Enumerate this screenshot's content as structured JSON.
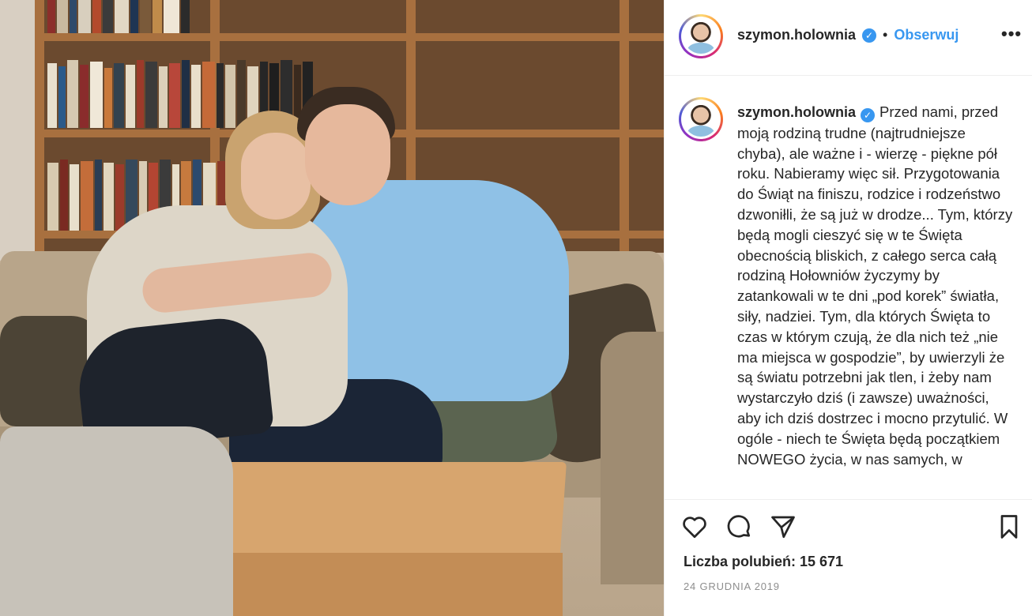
{
  "post": {
    "username": "szymon.holownia",
    "follow_label": "Obserwuj",
    "separator": "•",
    "more_label": "•••",
    "caption": "Przed nami, przed moją rodziną trudne (najtrudniejsze chyba), ale ważne i - wierzę - piękne pół roku. Nabieramy więc sił. Przygotowania do Świąt na finiszu, rodzice i rodzeństwo dzwoniłli, że są już w drodze... Tym, którzy będą mogli cieszyć się w te Święta obecnością bliskich, z całego serca całą rodziną Hołowniów życzymy by zatankowali w te dni „pod korek” światła, siły, nadziei. Tym, dla których Święta to czas w którym czują, że dla nich też „nie ma miejsca w gospodzie”, by uwierzyli że są światu potrzebni jak tlen, i żeby nam wystarczyło dziś (i zawsze) uważności, aby ich dziś dostrzec i mocno przytulić. W ogóle - niech te Święta będą początkiem NOWEGO życia, w nas samych, w",
    "likes_text": "Liczba polubień: 15 671",
    "date": "24 GRUDNIA 2019"
  },
  "icons": {
    "verified": "verified-badge-icon",
    "like": "heart-icon",
    "comment": "comment-icon",
    "share": "paper-plane-icon",
    "save": "bookmark-icon",
    "more": "more-options-icon"
  },
  "colors": {
    "accent_blue": "#3897f0",
    "text": "#262626",
    "muted": "#8e8e8e",
    "border": "#efefef"
  }
}
